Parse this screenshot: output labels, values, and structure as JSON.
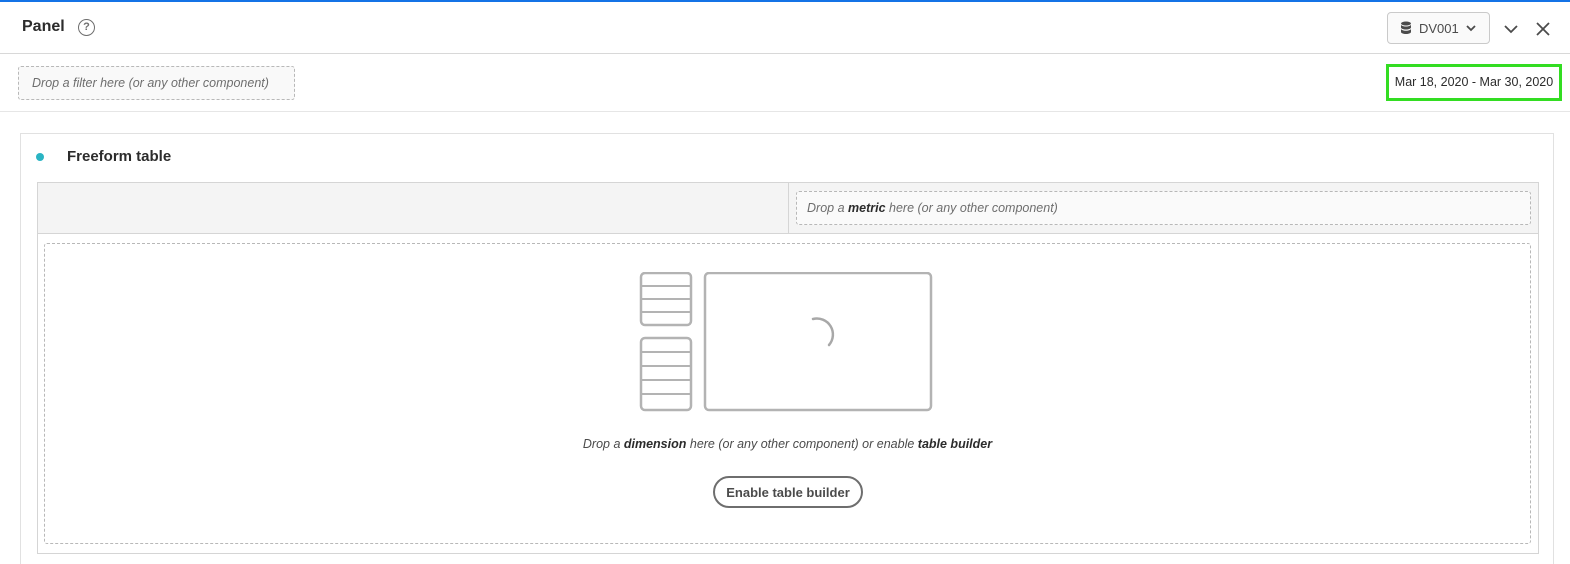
{
  "panel": {
    "title": "Panel",
    "help_icon": "help-circle-icon",
    "help_glyph": "?",
    "data_view": {
      "label": "DV001",
      "icon": "database-icon",
      "chevron": "chevron-down-icon"
    },
    "collapse_icon": "chevron-down-icon",
    "close_icon": "close-icon"
  },
  "filter_bar": {
    "drop_zone_text": "Drop a filter here (or any other component)",
    "date_range": "Mar 18, 2020 - Mar 30, 2020",
    "date_range_highlight_color": "#33dd22"
  },
  "freeform": {
    "title": "Freeform table",
    "status_dot_color": "#2ab4c3",
    "metric_drop": {
      "prefix": "Drop a ",
      "emphasis": "metric",
      "suffix": " here (or any other component)"
    },
    "dimension_drop": {
      "prefix": "Drop a ",
      "emphasis": "dimension",
      "middle": " here (or any other component) or enable ",
      "emphasis2": "table builder"
    },
    "illustration_icon": "table-builder-illustration-icon",
    "loading_icon": "spinner-icon",
    "enable_button_label": "Enable table builder"
  },
  "colors": {
    "accent_top": "#1473e6",
    "highlight": "#33dd22",
    "dot": "#2ab4c3"
  }
}
